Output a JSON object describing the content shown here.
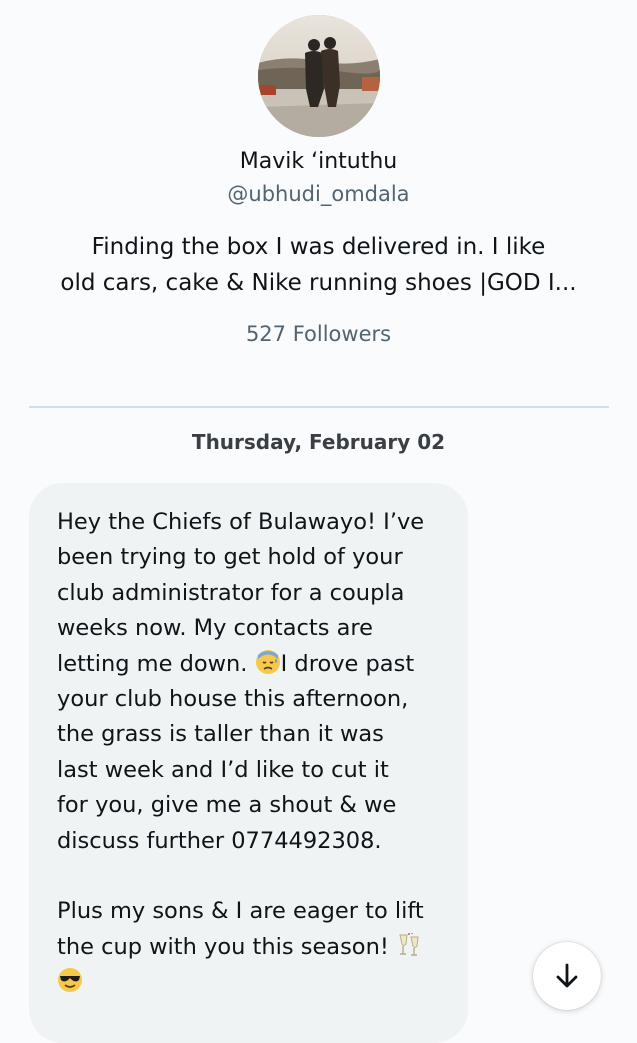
{
  "profile": {
    "display_name": "Mavik ‘intuthu",
    "handle": "@ubhudi_omdala",
    "bio_lines": [
      "Finding the box I was delivered in. I like",
      "old cars, cake & Nike running shoes |GOD I..."
    ],
    "followers": "527 Followers",
    "avatar_icon": "profile-photo"
  },
  "conversation": {
    "date_separator": "Thursday, February 02",
    "message": {
      "lines": [
        "Hey the Chiefs of Bulawayo! I’ve",
        "been trying to get hold of your",
        "club administrator for a coupla",
        "weeks now. My contacts are",
        "letting me down. ",
        "I drove past",
        "your club house this afternoon,",
        "the grass is taller than it was",
        "last week and I’d like to cut it",
        "for you, give me a shout & we",
        "discuss further 0774492308.",
        "Plus my sons & I are eager to lift",
        "the cup with you this season! "
      ],
      "emojis": [
        "downcast-sweat-emoji",
        "clinking-glasses-emoji",
        "sunglasses-emoji"
      ]
    }
  },
  "scroll_button": {
    "icon": "arrow-down-icon"
  },
  "colors": {
    "background": "#f9fbfc",
    "bubble": "#eff3f4",
    "secondary_text": "#536471",
    "divider": "#cfe0e8"
  }
}
